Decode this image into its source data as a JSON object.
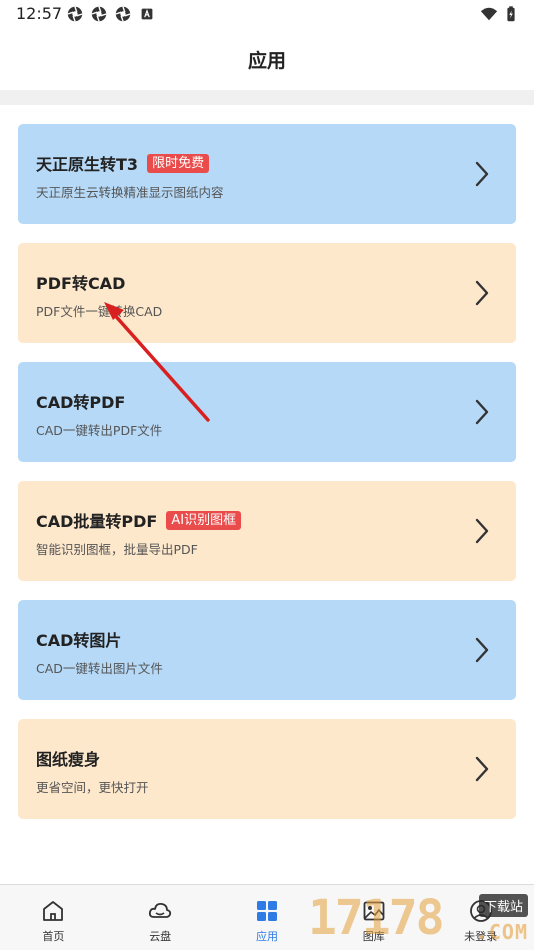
{
  "status_bar": {
    "time": "12:57",
    "left_icons": [
      "aperture-icon",
      "aperture-icon",
      "aperture-icon",
      "text-a-icon"
    ],
    "right_icons": [
      "wifi-icon",
      "battery-charging-icon"
    ]
  },
  "header": {
    "title": "应用"
  },
  "cards": [
    {
      "title": "天正原生转T3",
      "badge": "限时免费",
      "desc": "天正原生云转换精准显示图纸内容",
      "theme": "blue"
    },
    {
      "title": "PDF转CAD",
      "badge": "",
      "desc": "PDF文件一键转换CAD",
      "theme": "peach"
    },
    {
      "title": "CAD转PDF",
      "badge": "",
      "desc": "CAD一键转出PDF文件",
      "theme": "blue"
    },
    {
      "title": "CAD批量转PDF",
      "badge": "AI识别图框",
      "desc": "智能识别图框，批量导出PDF",
      "theme": "peach"
    },
    {
      "title": "CAD转图片",
      "badge": "",
      "desc": "CAD一键转出图片文件",
      "theme": "blue"
    },
    {
      "title": "图纸瘦身",
      "badge": "",
      "desc": "更省空间，更快打开",
      "theme": "peach"
    }
  ],
  "bottom_nav": [
    {
      "label": "首页",
      "icon": "home-icon",
      "active": false
    },
    {
      "label": "云盘",
      "icon": "cloud-icon",
      "active": false
    },
    {
      "label": "应用",
      "icon": "grid-icon",
      "active": true
    },
    {
      "label": "图库",
      "icon": "image-icon",
      "active": false
    },
    {
      "label": "未登录",
      "icon": "user-icon",
      "active": false
    }
  ],
  "colors": {
    "card_blue": "#b5d9f7",
    "card_peach": "#fde8cc",
    "badge_red": "#ea4b4b",
    "nav_active": "#2f7be6",
    "annotation_arrow": "#d92020"
  },
  "watermark": {
    "digits": "17178",
    "tag": "下载站",
    "domain": ".COM"
  }
}
